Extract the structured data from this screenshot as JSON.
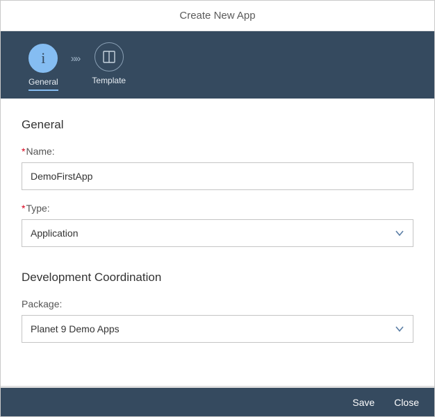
{
  "header": {
    "title": "Create New App"
  },
  "wizard": {
    "steps": [
      {
        "icon": "i",
        "label": "General",
        "active": true
      },
      {
        "icon": "template",
        "label": "Template",
        "active": false
      }
    ],
    "separator": "»»"
  },
  "sections": {
    "general": {
      "title": "General",
      "name": {
        "label": "Name:",
        "required": true,
        "value": "DemoFirstApp"
      },
      "type": {
        "label": "Type:",
        "required": true,
        "value": "Application"
      }
    },
    "devcoord": {
      "title": "Development Coordination",
      "package": {
        "label": "Package:",
        "required": false,
        "value": "Planet 9 Demo Apps"
      }
    }
  },
  "footer": {
    "save": "Save",
    "close": "Close"
  }
}
